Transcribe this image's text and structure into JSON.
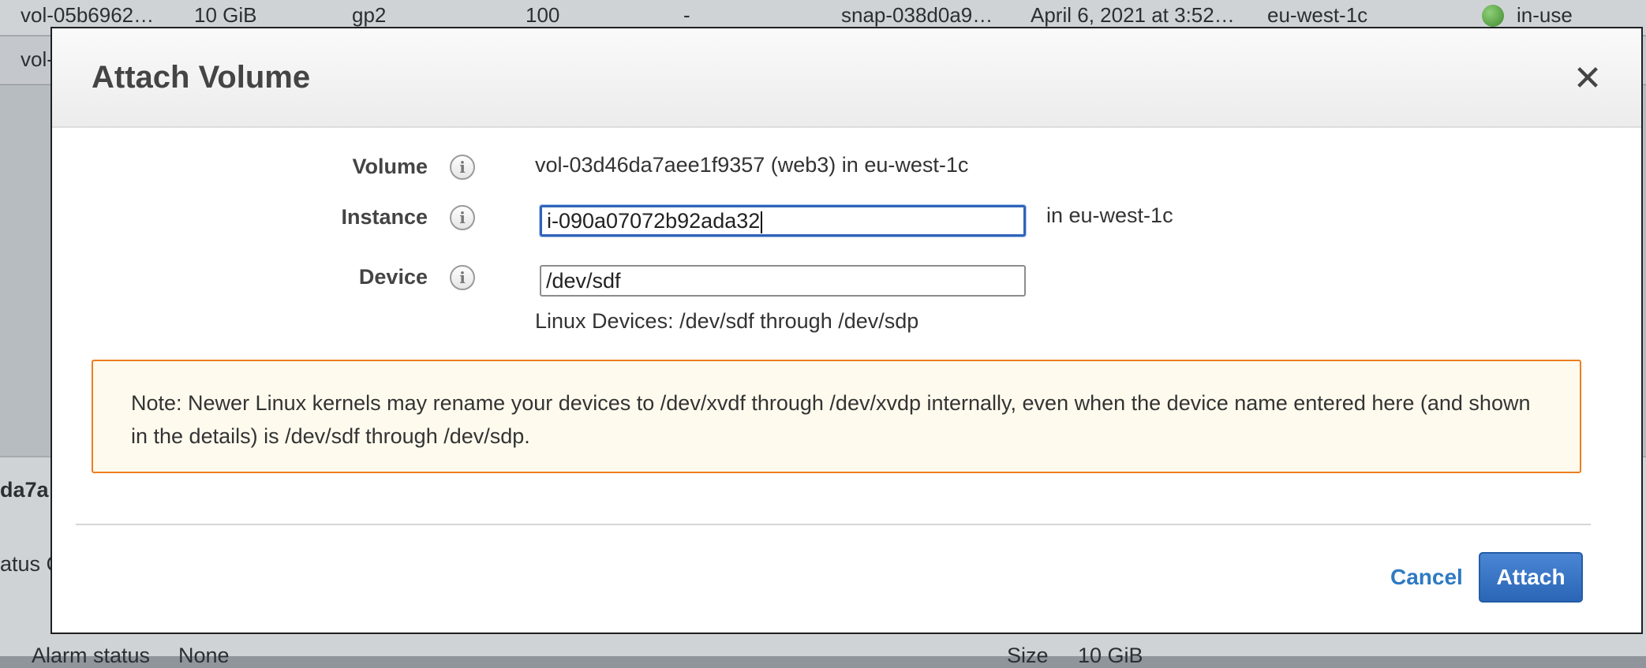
{
  "background": {
    "row1": {
      "volume_id": "vol-05b6962…",
      "size": "10 GiB",
      "type": "gp2",
      "iops": "100",
      "throughput": "-",
      "snapshot": "snap-038d0a9…",
      "created": "April 6, 2021 at 3:52…",
      "zone": "eu-west-1c",
      "state": "in-use"
    },
    "row2": {
      "volume_id": "vol-"
    },
    "detail_fragment_1": "da7a",
    "detail_fragment_2": "atus C",
    "alarm_label": "Alarm status",
    "alarm_value": "None",
    "size_label": "Size",
    "size_value": "10 GiB"
  },
  "modal": {
    "title": "Attach Volume",
    "close_symbol": "✕",
    "info_symbol": "i",
    "volume_label": "Volume",
    "volume_value": "vol-03d46da7aee1f9357 (web3) in eu-west-1c",
    "instance_label": "Instance",
    "instance_value": "i-090a07072b92ada32",
    "instance_zone": "in eu-west-1c",
    "device_label": "Device",
    "device_value": "/dev/sdf",
    "device_hint": "Linux Devices: /dev/sdf through /dev/sdp",
    "note": "Note: Newer Linux kernels may rename your devices to /dev/xvdf through /dev/xvdp internally, even when the device name entered here (and shown in the details) is /dev/sdf through /dev/sdp.",
    "cancel_label": "Cancel",
    "attach_label": "Attach"
  }
}
